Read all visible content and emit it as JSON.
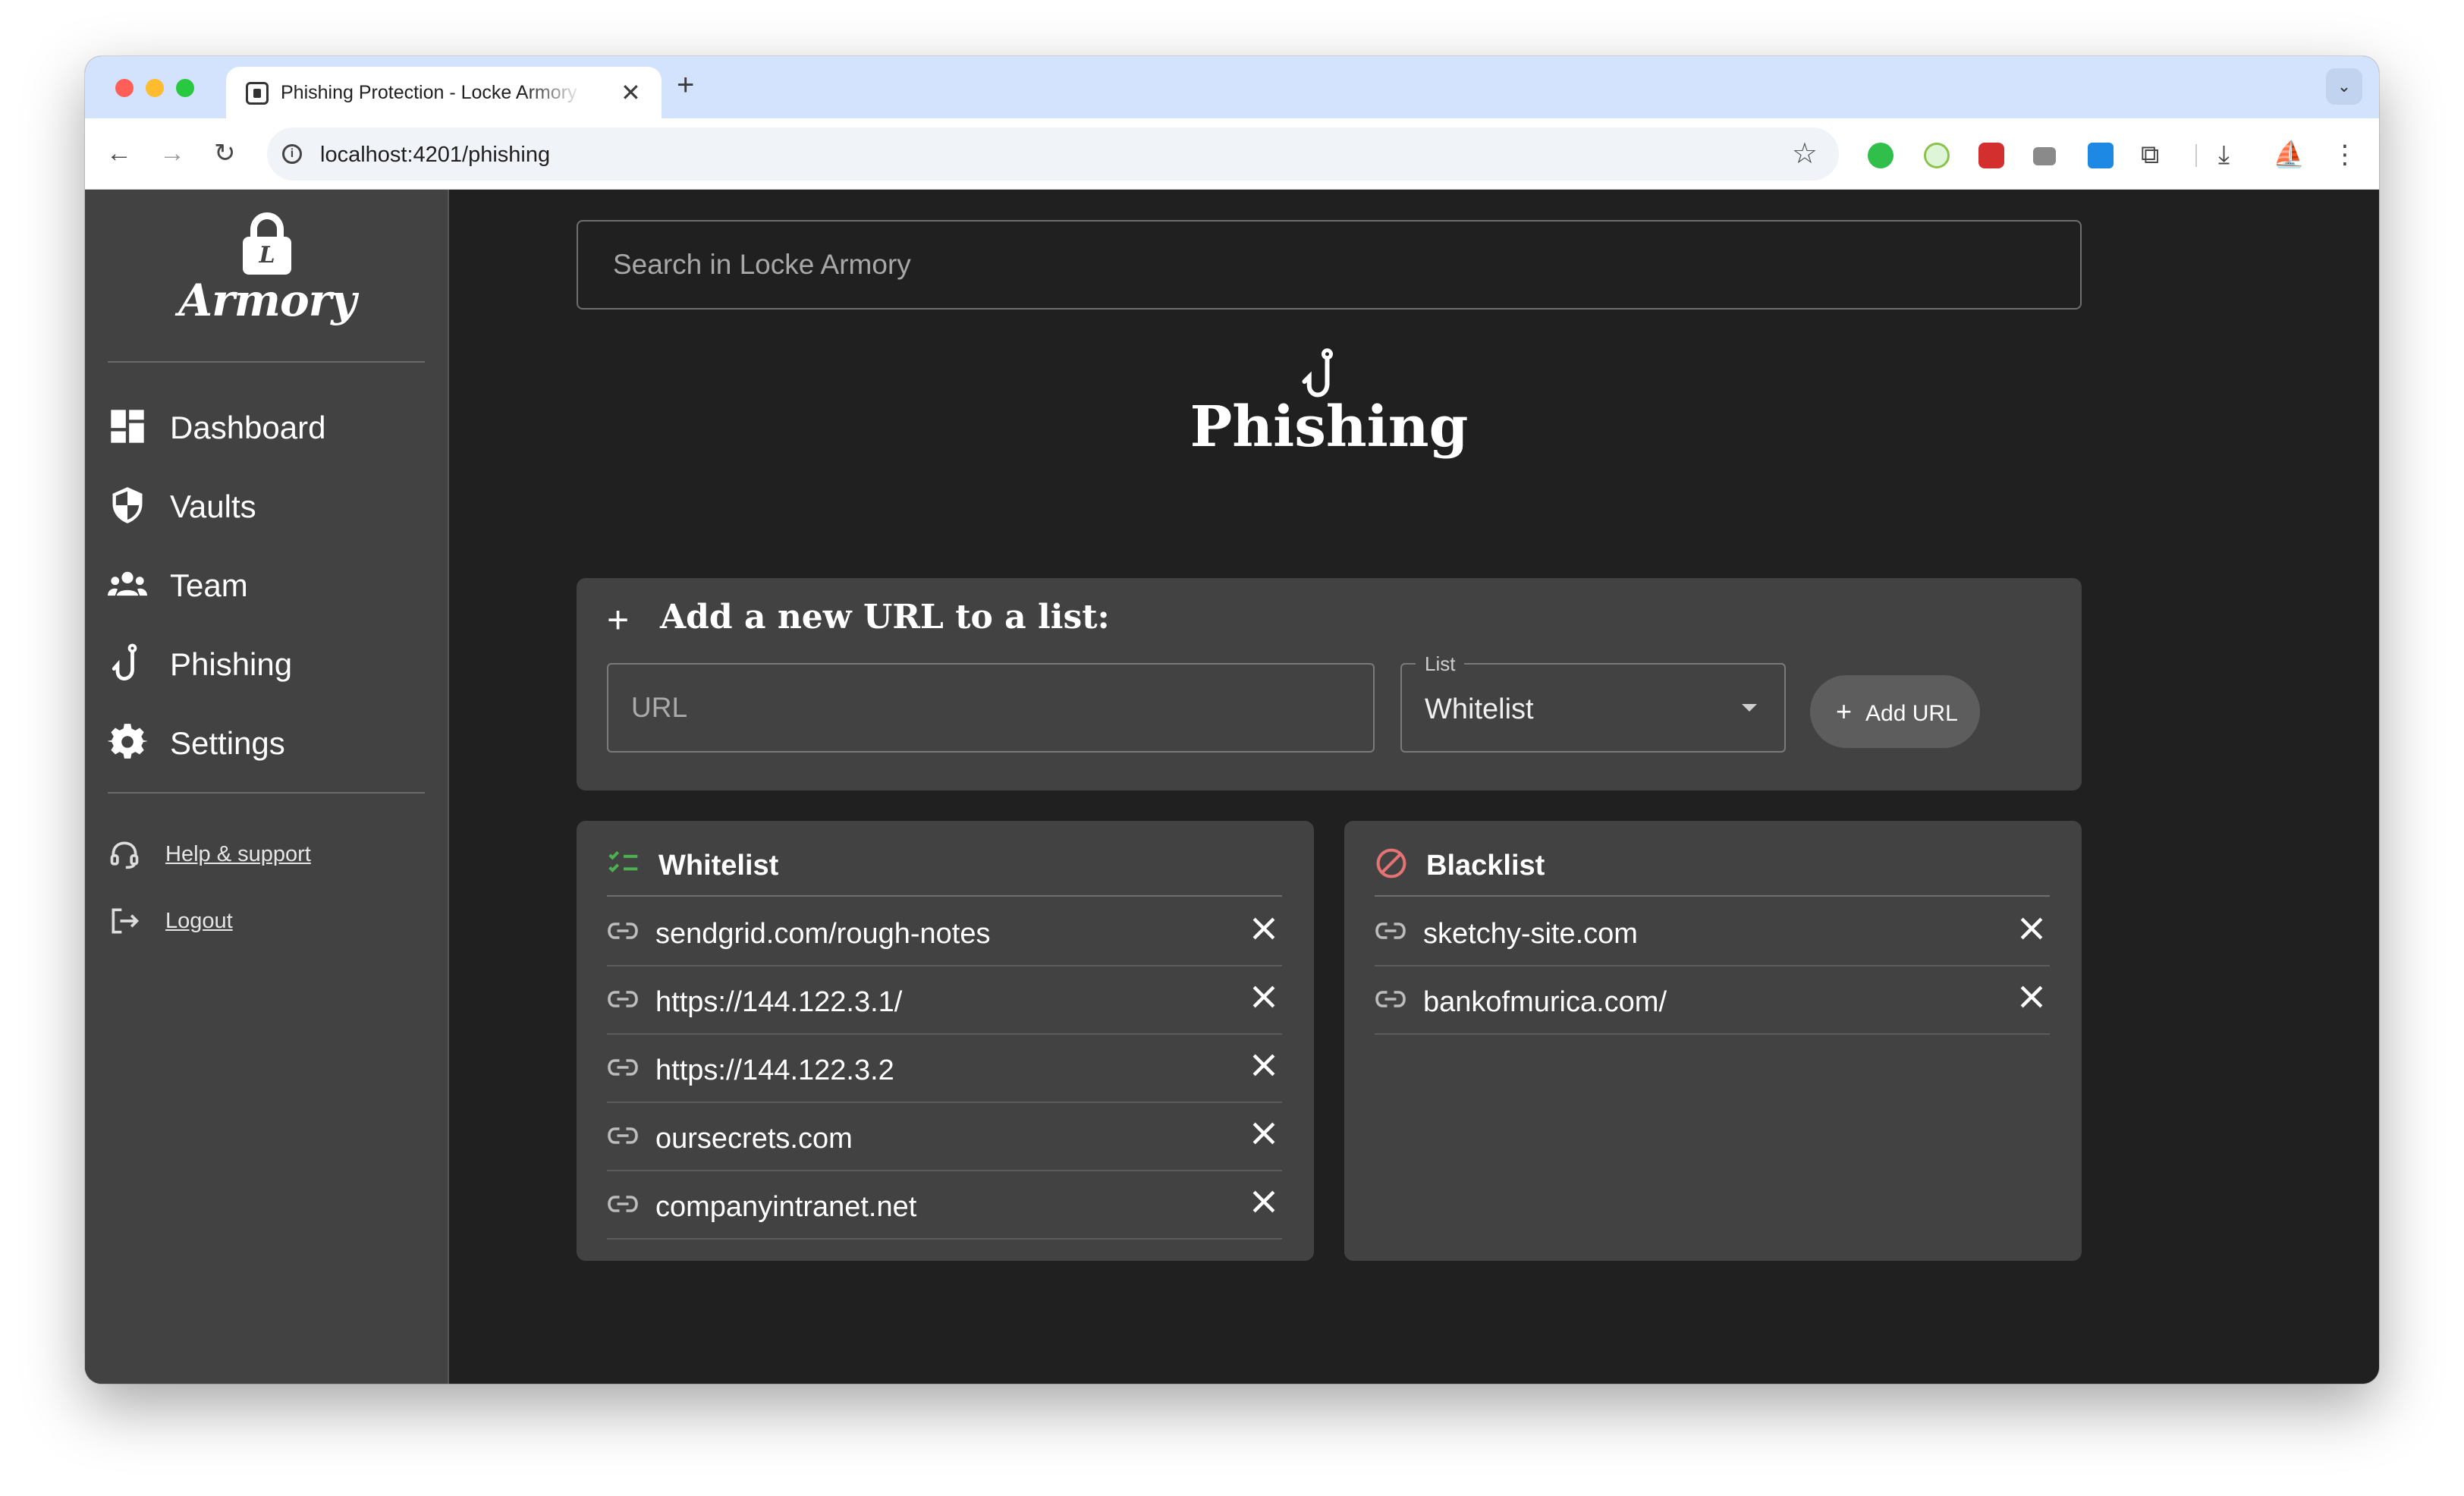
{
  "browser": {
    "tab_title": "Phishing Protection - Locke Armory",
    "tab_close": "✕",
    "new_tab": "+",
    "tab_dropdown": "⌄",
    "url": "localhost:4201/phishing",
    "back": "←",
    "forward": "→",
    "reload": "↻",
    "star": "☆",
    "menu": "⋮"
  },
  "sidebar": {
    "logo_letter": "L",
    "logo_text": "Armory",
    "nav": [
      {
        "label": "Dashboard",
        "icon": "dashboard-icon"
      },
      {
        "label": "Vaults",
        "icon": "shield-icon"
      },
      {
        "label": "Team",
        "icon": "team-icon"
      },
      {
        "label": "Phishing",
        "icon": "fishhook-icon"
      },
      {
        "label": "Settings",
        "icon": "gear-icon"
      }
    ],
    "support": {
      "label": "Help & support",
      "icon": "headset-icon"
    },
    "logout": {
      "label": "Logout",
      "icon": "logout-icon"
    }
  },
  "search": {
    "placeholder": "Search in Locke Armory"
  },
  "page": {
    "title": "Phishing",
    "icon": "fishhook-icon"
  },
  "add_form": {
    "plus": "+",
    "title": "Add a new URL to a list:",
    "url_placeholder": "URL",
    "list_label": "List",
    "list_value": "Whitelist",
    "button_plus": "+",
    "button_label": "Add URL"
  },
  "whitelist": {
    "title": "Whitelist",
    "accent": "#4caf50",
    "items": [
      "sendgrid.com/rough-notes",
      "https://144.122.3.1/",
      "https://144.122.3.2",
      "oursecrets.com",
      "companyintranet.net"
    ]
  },
  "blacklist": {
    "title": "Blacklist",
    "accent": "#e57373",
    "items": [
      "sketchy-site.com",
      "bankofmurica.com/"
    ]
  }
}
